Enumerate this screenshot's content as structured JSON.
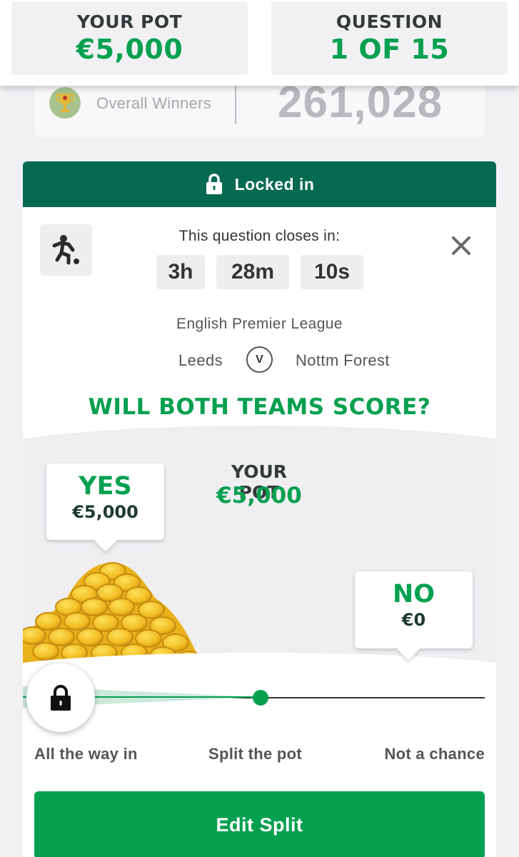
{
  "header": {
    "pot_label": "YOUR POT",
    "pot_value": "€5,000",
    "question_label": "QUESTION",
    "question_value": "1 OF 15"
  },
  "winners": {
    "label": "Overall Winners",
    "count": "261,028",
    "icon": "trophy-icon"
  },
  "status": {
    "locked_label": "Locked in",
    "icon": "lock-icon"
  },
  "question": {
    "sport_icon": "football-player-icon",
    "closes_label": "This question closes in:",
    "timer": {
      "hours": "3h",
      "minutes": "28m",
      "seconds": "10s"
    },
    "league": "English Premier League",
    "home_team": "Leeds",
    "versus": "V",
    "away_team": "Nottm Forest",
    "title": "WILL BOTH TEAMS SCORE?"
  },
  "split": {
    "pot_label": "YOUR POT",
    "pot_value": "€5,000",
    "yes": {
      "label": "YES",
      "amount": "€5,000"
    },
    "no": {
      "label": "NO",
      "amount": "€0"
    },
    "slider": {
      "left_label": "All the way in",
      "mid_label": "Split the pot",
      "right_label": "Not a chance",
      "position_fraction": 0.0
    }
  },
  "actions": {
    "edit_label": "Edit Split"
  },
  "colors": {
    "brand_green": "#04a050",
    "dark_green": "#056a50",
    "coin_gold": "#f2c230"
  }
}
